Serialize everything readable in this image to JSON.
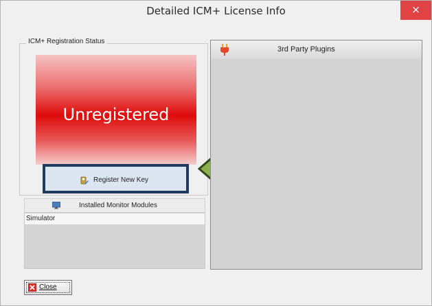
{
  "window": {
    "title": "Detailed ICM+ License Info",
    "close_glyph": "×"
  },
  "registration": {
    "group_label": "ICM+ Registration Status",
    "status": "Unregistered",
    "status_color": "#df0b0b",
    "register_button": "Register New Key",
    "register_icon": "key-pencil-icon"
  },
  "monitor_modules": {
    "header": "Installed Monitor Modules",
    "icon": "monitor-icon",
    "items": [
      "Simulator"
    ]
  },
  "plugins": {
    "header": "3rd Party Plugins",
    "icon": "plug-icon",
    "items": []
  },
  "footer": {
    "close_button": "Close",
    "close_icon": "red-x-icon"
  },
  "annotation": {
    "type": "arrow",
    "direction": "left",
    "color": "#8db04a",
    "border_color": "#2e4a1c"
  }
}
